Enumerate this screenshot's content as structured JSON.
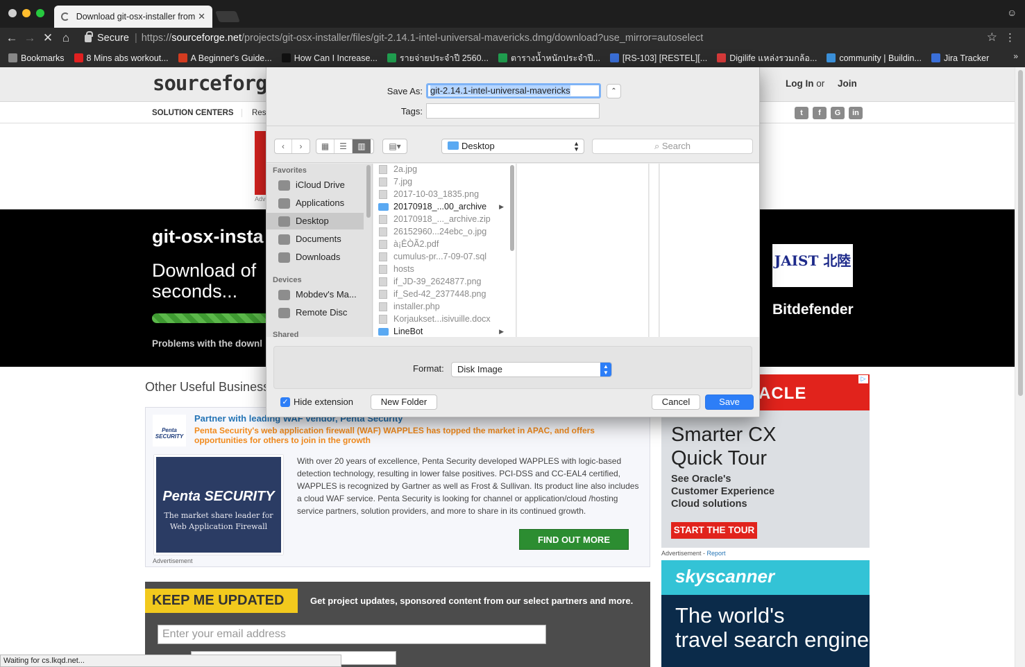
{
  "browser": {
    "tab_title": "Download git-osx-installer from",
    "tab_close": "✕",
    "secure_label": "Secure",
    "url_scheme": "https://",
    "url_host": "sourceforge.net",
    "url_path": "/projects/git-osx-installer/files/git-2.14.1-intel-universal-mavericks.dmg/download?use_mirror=autoselect",
    "bookmarks": [
      {
        "label": "Bookmarks",
        "color": "#888888"
      },
      {
        "label": "8 Mins abs workout...",
        "color": "#e02020"
      },
      {
        "label": "A Beginner's Guide...",
        "color": "#d33b20"
      },
      {
        "label": "How Can I Increase...",
        "color": "#111111"
      },
      {
        "label": "รายจ่ายประจำปี 2560...",
        "color": "#20a050"
      },
      {
        "label": "ตารางน้ำหนักประจำปี...",
        "color": "#20a050"
      },
      {
        "label": "[RS-103] [RESTEL][...",
        "color": "#3a6fd8"
      },
      {
        "label": "Digilife แหล่งรวมกล้อ...",
        "color": "#d83a3a"
      },
      {
        "label": "community | Buildin...",
        "color": "#3a8fd8"
      },
      {
        "label": "Jira Tracker",
        "color": "#3a6fd8"
      }
    ],
    "bookmarks_more": "»",
    "status_text": "Waiting for cs.lkqd.net..."
  },
  "page": {
    "logo": "sourceforg",
    "login": "Log In",
    "or": "or",
    "join": "Join",
    "nav_solution_centers": "SOLUTION CENTERS",
    "nav_res": "Res",
    "social": [
      "t",
      "f",
      "G",
      "in"
    ],
    "ad_label": "Adv",
    "hero_title": "git-osx-insta",
    "hero_sub_1": "Download of",
    "hero_sub_2": "seconds...",
    "download_progress": 1.0,
    "hero_problems": "Problems with the downl",
    "sponsor_jaist": "JAIST 北陸",
    "sponsor_bitdefender": "Bitdefender",
    "other_title": "Other Useful Business",
    "penta": {
      "logo_small": "Penta SECURITY",
      "headline": "Partner with leading WAF vendor, Penta Security",
      "tagline": "Penta Security's web application firewall (WAF) WAPPLES has topped the market in APAC, and offers opportunities for others to join in the growth",
      "img_title": "Penta SECURITY",
      "img_sub": "The market share leader for Web Application Firewall",
      "body": "With over 20 years of excellence, Penta Security developed WAPPLES with logic-based detection technology, resulting in lower false positives. PCI-DSS and CC-EAL4 certified, WAPPLES is recognized by Gartner as well as Frost & Sullivan. Its product line also includes a cloud WAF service. Penta Security is looking for channel or application/cloud /hosting service partners, solution providers, and more to share in its continued growth.",
      "cta": "FIND OUT MORE",
      "adv": "Advertisement"
    },
    "keep": {
      "badge": "KEEP ME UPDATED",
      "text": "Get project updates, sponsored content from our select partners and more.",
      "email_placeholder": "Enter your email address"
    },
    "oracle": {
      "brand": "ACLE",
      "big_1": "Smarter CX",
      "big_2": "Quick Tour",
      "small_1": "See Oracle's",
      "small_2": "Customer Experience",
      "small_3": "Cloud solutions",
      "cta": "START THE TOUR",
      "adv": "Advertisement - ",
      "report": "Report"
    },
    "skyscanner": {
      "brand": "skyscanner",
      "line_1": "The world's",
      "line_2": "travel search engine"
    }
  },
  "dialog": {
    "save_as_label": "Save As:",
    "save_as_value": "git-2.14.1-intel-universal-mavericks",
    "tags_label": "Tags:",
    "expand": "⌃",
    "location": "Desktop",
    "search_placeholder": "Search",
    "sidebar": {
      "favorites_header": "Favorites",
      "favorites": [
        {
          "label": "iCloud Drive",
          "icon": "cloud-icon"
        },
        {
          "label": "Applications",
          "icon": "applications-icon"
        },
        {
          "label": "Desktop",
          "icon": "desktop-icon",
          "selected": true
        },
        {
          "label": "Documents",
          "icon": "documents-icon"
        },
        {
          "label": "Downloads",
          "icon": "downloads-icon"
        }
      ],
      "devices_header": "Devices",
      "devices": [
        {
          "label": "Mobdev's Ma...",
          "icon": "laptop-icon"
        },
        {
          "label": "Remote Disc",
          "icon": "disc-icon"
        }
      ],
      "shared_header": "Shared"
    },
    "files": [
      {
        "name": "2a.jpg",
        "folder": false
      },
      {
        "name": "7.jpg",
        "folder": false
      },
      {
        "name": "2017-10-03_1835.png",
        "folder": false
      },
      {
        "name": "20170918_...00_archive",
        "folder": true
      },
      {
        "name": "20170918_..._archive.zip",
        "folder": false
      },
      {
        "name": "26152960...24ebc_o.jpg",
        "folder": false
      },
      {
        "name": "à¡ÊÒÃ2.pdf",
        "folder": false
      },
      {
        "name": "cumulus-pr...7-09-07.sql",
        "folder": false
      },
      {
        "name": "hosts",
        "folder": false
      },
      {
        "name": "if_JD-39_2624877.png",
        "folder": false
      },
      {
        "name": "if_Sed-42_2377448.png",
        "folder": false
      },
      {
        "name": "installer.php",
        "folder": false
      },
      {
        "name": "Korjaukset...isivuille.docx",
        "folder": false
      },
      {
        "name": "LineBot",
        "folder": true
      }
    ],
    "format_label": "Format:",
    "format_value": "Disk Image",
    "hide_extension": "Hide extension",
    "new_folder": "New Folder",
    "cancel": "Cancel",
    "save": "Save"
  }
}
